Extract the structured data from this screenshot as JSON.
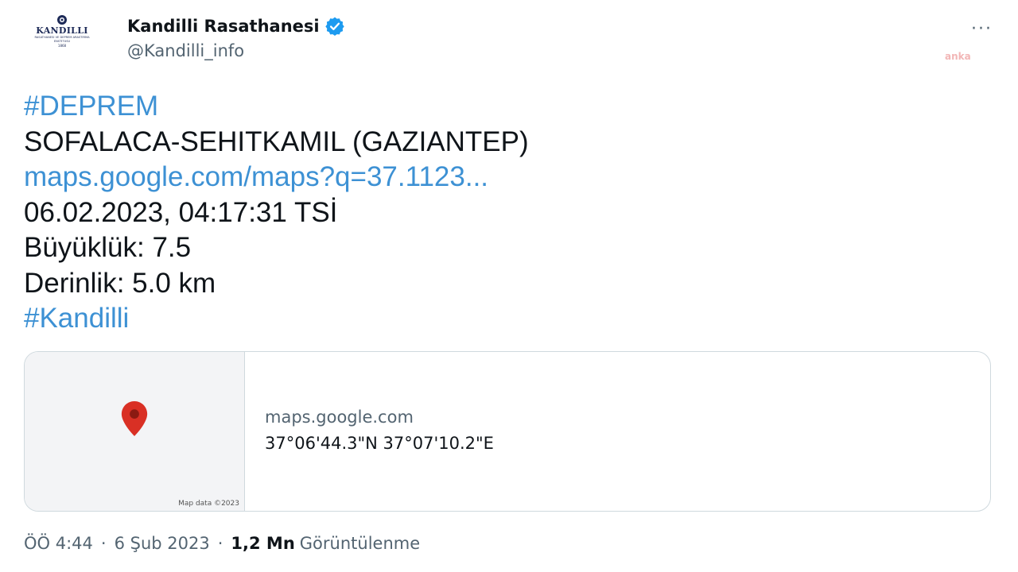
{
  "header": {
    "logo_text": "KANDILLI",
    "logo_subtext": "RASATHANESI VE DEPREM ARASTIRMA ENSTITUSU",
    "logo_year": "1868",
    "display_name": "Kandilli Rasathanesi",
    "handle": "@Kandilli_info",
    "more_icon": "···",
    "watermark": "anka"
  },
  "tweet": {
    "hashtag_deprem": "#DEPREM",
    "location": "SOFALACA-SEHITKAMIL (GAZIANTEP)",
    "map_link": "maps.google.com/maps?q=37.1123...",
    "datetime": "06.02.2023, 04:17:31 TSİ",
    "magnitude": "Büyüklük: 7.5",
    "depth": "Derinlik: 5.0 km",
    "hashtag_kandilli": "#Kandilli"
  },
  "card": {
    "map_credit": "Map data ©2023",
    "domain": "maps.google.com",
    "coordinates": "37°06'44.3\"N 37°07'10.2\"E"
  },
  "meta": {
    "time": "ÖÖ 4:44",
    "date": "6 Şub 2023",
    "views_count": "1,2 Mn",
    "views_label": "Görüntülenme",
    "separator": "·"
  },
  "colors": {
    "link": "#3d91d4",
    "verified": "#1d9bf0",
    "pin": "#d93025"
  }
}
